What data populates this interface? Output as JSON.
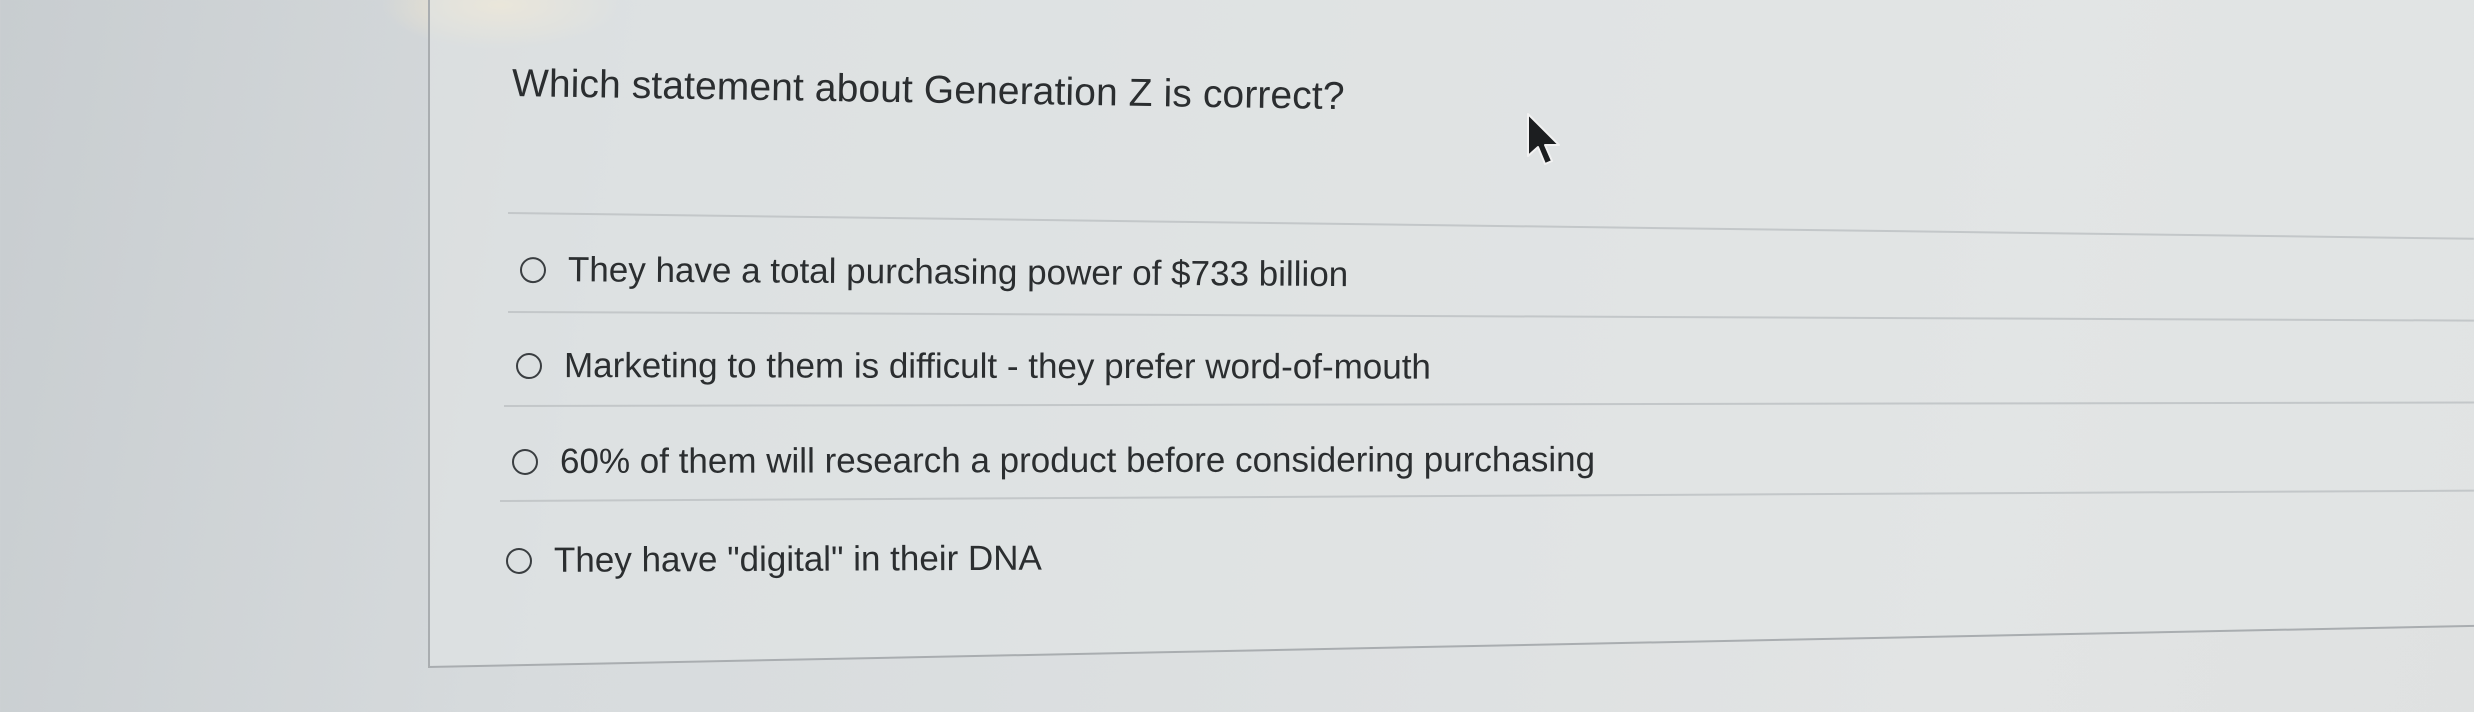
{
  "question": {
    "prompt": "Which statement about Generation Z is correct?"
  },
  "options": [
    {
      "label": "They have a total purchasing power of $733 billion",
      "selected": false
    },
    {
      "label": "Marketing to them is difficult - they prefer word-of-mouth",
      "selected": false
    },
    {
      "label": "60% of them will research a product before considering purchasing",
      "selected": false
    },
    {
      "label": "They have \"digital\" in their DNA",
      "selected": false
    }
  ],
  "cursor": {
    "icon": "mouse-pointer-arrow-icon"
  }
}
